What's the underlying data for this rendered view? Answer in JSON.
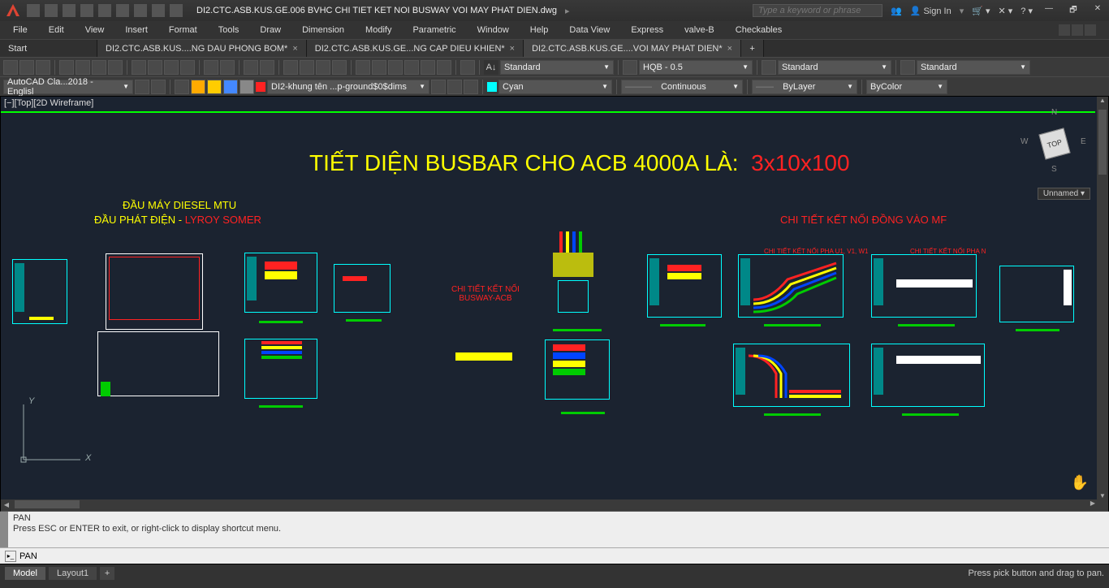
{
  "titlebar": {
    "title": "DI2.CTC.ASB.KUS.GE.006 BVHC CHI TIET KET NOI BUSWAY VOI MAY PHAT DIEN.dwg",
    "search_placeholder": "Type a keyword or phrase",
    "signin": "Sign In"
  },
  "menu": [
    "File",
    "Edit",
    "View",
    "Insert",
    "Format",
    "Tools",
    "Draw",
    "Dimension",
    "Modify",
    "Parametric",
    "Window",
    "Help",
    "Data View",
    "Express",
    "valve-B",
    "Checkables"
  ],
  "filetabs": {
    "start": "Start",
    "tabs": [
      {
        "label": "DI2.CTC.ASB.KUS....NG DAU PHONG BOM*",
        "active": false
      },
      {
        "label": "DI2.CTC.ASB.KUS.GE...NG CAP DIEU KHIEN*",
        "active": false
      },
      {
        "label": "DI2.CTC.ASB.KUS.GE....VOI MAY PHAT DIEN*",
        "active": true
      }
    ]
  },
  "toolbar1": {
    "text_style": "Standard",
    "dim_style": "HQB - 0.5",
    "table_style": "Standard",
    "ml_style": "Standard"
  },
  "toolbar2": {
    "workspace": "AutoCAD Cla...2018 - Englisl",
    "layer": "DI2-khung tên ...p-ground$0$dims",
    "color": "Cyan",
    "linetype": "Continuous",
    "lineweight": "ByLayer",
    "plotstyle": "ByColor"
  },
  "canvas": {
    "view_label": "[−][Top][2D Wireframe]",
    "big_title_a": "TIẾT DIỆN BUSBAR CHO ACB 4000A LÀ:",
    "big_title_b": "3x10x100",
    "label1a": "ĐẦU MÁY DIESEL MTU",
    "label1b": "ĐẦU PHÁT ĐIỆN - ",
    "label1c": "LYROY SOMER",
    "label2a": "CHI TIẾT KẾT NỐI",
    "label2b": "BUSWAY-ACB",
    "label3": "CHI TIẾT KẾT NỐI ĐỒNG VÀO MF",
    "label4": "CHI TIẾT KẾT NỐI PHA U1, V1, W1",
    "label5": "CHI TIẾT KẾT NỐI PHA N",
    "navcube": {
      "n": "N",
      "s": "S",
      "e": "E",
      "w": "W",
      "top": "TOP"
    },
    "unnamed": "Unnamed",
    "ucs_x": "X",
    "ucs_y": "Y"
  },
  "cmd": {
    "line1": "PAN",
    "line2": "Press ESC or ENTER to exit, or right-click to display shortcut menu.",
    "prompt": " PAN"
  },
  "status": {
    "model": "Model",
    "layout": "Layout1",
    "right": "Press pick button and drag to pan."
  }
}
